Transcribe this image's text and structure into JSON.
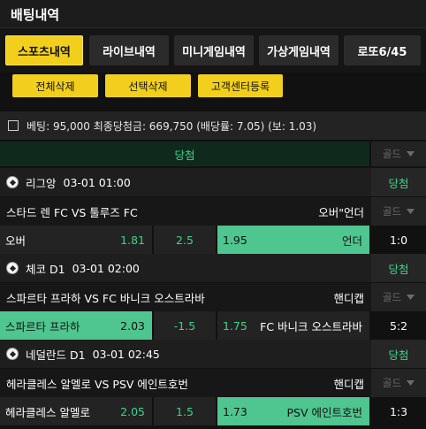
{
  "header": {
    "title": "배팅내역"
  },
  "tabs": [
    {
      "label": "스포츠내역",
      "active": true
    },
    {
      "label": "라이브내역",
      "active": false
    },
    {
      "label": "미니게임내역",
      "active": false
    },
    {
      "label": "가상게임내역",
      "active": false
    },
    {
      "label": "로또6/45",
      "active": false
    }
  ],
  "actions": {
    "delete_all": "전체삭제",
    "delete_selected": "선택삭제",
    "register_support": "고객센터등록"
  },
  "summary": {
    "text": "베팅: 95,000 최종당첨금: 669,750 (배당률: 7.05) (보: 1.03)"
  },
  "result": {
    "label": "당첨",
    "gold_label": "골드"
  },
  "matches": [
    {
      "league": "리그앙",
      "datetime": "03-01 01:00",
      "status": "당첨",
      "teams": "스타드 렌 FC VS 툴루즈 FC",
      "market": "오버\"언더",
      "gold": "골드",
      "home_label": "오버",
      "home_odds": "1.81",
      "line": "2.5",
      "away_odds": "1.95",
      "away_label": "언더",
      "selected": "away",
      "score": "1:0"
    },
    {
      "league": "체코 D1",
      "datetime": "03-01 02:00",
      "status": "당첨",
      "teams": "스파르타 프라하 VS FC 바니크 오스트라바",
      "market": "핸디캡",
      "gold": "골드",
      "home_label": "스파르타 프라하",
      "home_odds": "2.03",
      "line": "-1.5",
      "away_odds": "1.75",
      "away_label": "FC 바니크 오스트라바",
      "selected": "home",
      "score": "5:2"
    },
    {
      "league": "네덜란드 D1",
      "datetime": "03-01 02:45",
      "status": "당첨",
      "teams": "헤라클레스 알멜로 VS PSV 에인트호번",
      "market": "핸디캡",
      "gold": "골드",
      "home_label": "헤라클레스 알멜로",
      "home_odds": "2.05",
      "line": "1.5",
      "away_odds": "1.73",
      "away_label": "PSV 에인트호번",
      "selected": "away",
      "score": "1:3"
    }
  ],
  "icons": {
    "league": "soccer-ball-icon",
    "dropdown": "caret-down-icon",
    "checkbox": "checkbox-icon"
  },
  "colors": {
    "accent": "#f2cf1d",
    "win": "#3fd18f",
    "selected_cell": "#4fc58f"
  }
}
